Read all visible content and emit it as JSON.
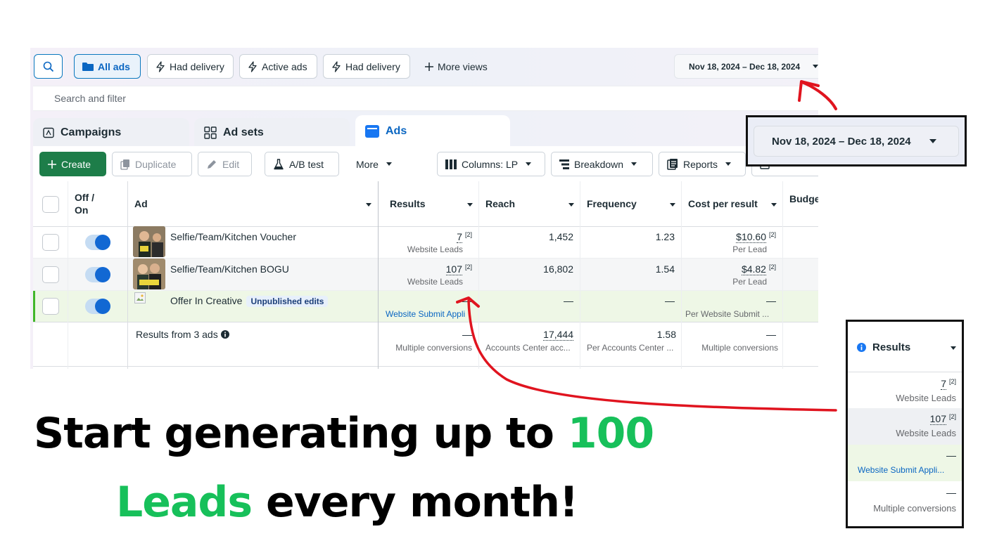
{
  "filter_bar": {
    "all_ads": "All ads",
    "had_delivery_1": "Had delivery",
    "active_ads": "Active ads",
    "had_delivery_2": "Had delivery",
    "more_views": "More views",
    "date_range": "Nov 18, 2024 – Dec 18, 2024"
  },
  "search": {
    "placeholder": "Search and filter"
  },
  "tabs": {
    "campaigns": "Campaigns",
    "ad_sets": "Ad sets",
    "ads": "Ads"
  },
  "toolbar": {
    "create": "Create",
    "duplicate": "Duplicate",
    "edit": "Edit",
    "ab_test": "A/B test",
    "more": "More",
    "columns": "Columns: LP",
    "breakdown": "Breakdown",
    "reports": "Reports"
  },
  "table": {
    "headers": {
      "off_on_1": "Off /",
      "off_on_2": "On",
      "ad": "Ad",
      "results": "Results",
      "reach": "Reach",
      "frequency": "Frequency",
      "cost_per_result": "Cost per result",
      "budget": "Budge"
    },
    "rows": [
      {
        "name": "Selfie/Team/Kitchen Voucher",
        "results": "7",
        "results_sup": "[2]",
        "results_sub": "Website Leads",
        "reach": "1,452",
        "frequency": "1.23",
        "cost": "$10.60",
        "cost_sup": "[2]",
        "cost_sub": "Per Lead"
      },
      {
        "name": "Selfie/Team/Kitchen BOGU",
        "results": "107",
        "results_sup": "[2]",
        "results_sub": "Website Leads",
        "reach": "16,802",
        "frequency": "1.54",
        "cost": "$4.82",
        "cost_sup": "[2]",
        "cost_sub": "Per Lead"
      },
      {
        "name": "Offer In Creative",
        "badge": "Unpublished edits",
        "results": "—",
        "results_sub": "Website Submit Appli",
        "reach": "—",
        "frequency": "—",
        "cost": "—",
        "cost_sub": "Per Website Submit ..."
      }
    ],
    "summary": {
      "label": "Results from 3 ads",
      "results": "—",
      "results_sub": "Multiple conversions",
      "reach": "17,444",
      "reach_sub": "Accounts Center acc...",
      "frequency": "1.58",
      "frequency_sub": "Per Accounts Center ...",
      "cost": "—",
      "cost_sub": "Multiple conversions"
    }
  },
  "zoom_date": {
    "date_range": "Nov 18, 2024 – Dec 18, 2024"
  },
  "zoom_results": {
    "header": "Results",
    "rows": [
      {
        "value": "7",
        "sup": "[2]",
        "sub": "Website Leads"
      },
      {
        "value": "107",
        "sup": "[2]",
        "sub": "Website Leads"
      },
      {
        "value": "—",
        "sub": "Website Submit Appli..."
      },
      {
        "value": "—",
        "sub": "Multiple conversions"
      }
    ]
  },
  "headline": {
    "line1_black": "Start generating up to ",
    "line1_green": "100",
    "line2_green": "Leads",
    "line2_black": " every month!"
  },
  "colors": {
    "accent_blue": "#0a66c2",
    "create_green": "#1d7d49",
    "headline_green": "#17c05a",
    "arrow_red": "#e0141f",
    "highlight_row": "#eef7e6"
  }
}
